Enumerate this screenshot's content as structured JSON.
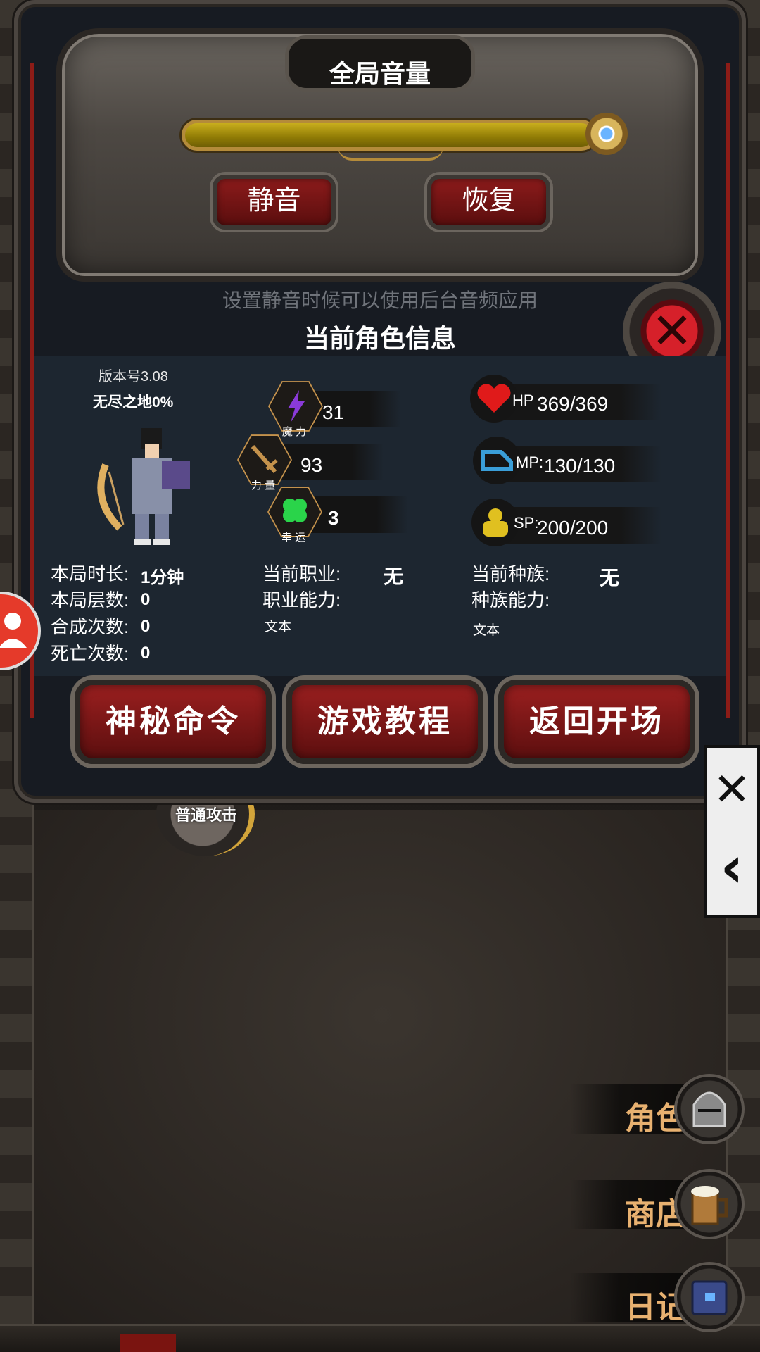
{
  "volume": {
    "title": "全局音量",
    "level": 1.0,
    "mute_label": "静音",
    "restore_label": "恢复",
    "hint": "设置静音时候可以使用后台音频应用"
  },
  "character": {
    "section_title": "当前角色信息",
    "version": "版本号3.08",
    "realm": "无尽之地0%",
    "stats": {
      "magic": {
        "caption": "魔 力",
        "value": "31"
      },
      "strength": {
        "caption": "力 量",
        "value": "93"
      },
      "luck": {
        "caption": "幸 运",
        "value": "3"
      }
    },
    "vitals": {
      "hp": {
        "label": "HP",
        "value": "369/369"
      },
      "mp": {
        "label": "MP:",
        "value": "130/130"
      },
      "sp": {
        "label": "SP:",
        "value": "200/200"
      }
    },
    "run": {
      "duration_label": "本局时长:",
      "duration_value": "1分钟",
      "floors_label": "本局层数:",
      "floors_value": "0",
      "synth_label": "合成次数:",
      "synth_value": "0",
      "deaths_label": "死亡次数:",
      "deaths_value": "0"
    },
    "job": {
      "label": "当前职业:",
      "value": "无",
      "ability_label": "职业能力:",
      "ability_text": "文本"
    },
    "race": {
      "label": "当前种族:",
      "value": "无",
      "ability_label": "种族能力:",
      "ability_text": "文本"
    }
  },
  "buttons": {
    "secret": "神秘命令",
    "tutorial": "游戏教程",
    "back": "返回开场"
  },
  "overlay": {
    "collapse_close": "✕",
    "collapse_back": "‹"
  },
  "battle": {
    "attack_label": "普通攻击"
  },
  "side_menu": {
    "character": "角色",
    "shop": "商店",
    "diary": "日记"
  },
  "colors": {
    "accent_red": "#8c1b1b",
    "gold": "#c8ae1d",
    "menu_text": "#e8b170",
    "close_red": "#d6202a"
  },
  "icons": {
    "magic": "lightning-icon",
    "strength": "sword-icon",
    "luck": "clover-icon",
    "hp": "heart-icon",
    "mp": "blue-shoe-icon",
    "sp": "muscle-icon",
    "character": "helmet-icon",
    "shop": "beer-mug-icon",
    "diary": "book-icon",
    "close": "close-icon",
    "profile": "person-icon"
  }
}
